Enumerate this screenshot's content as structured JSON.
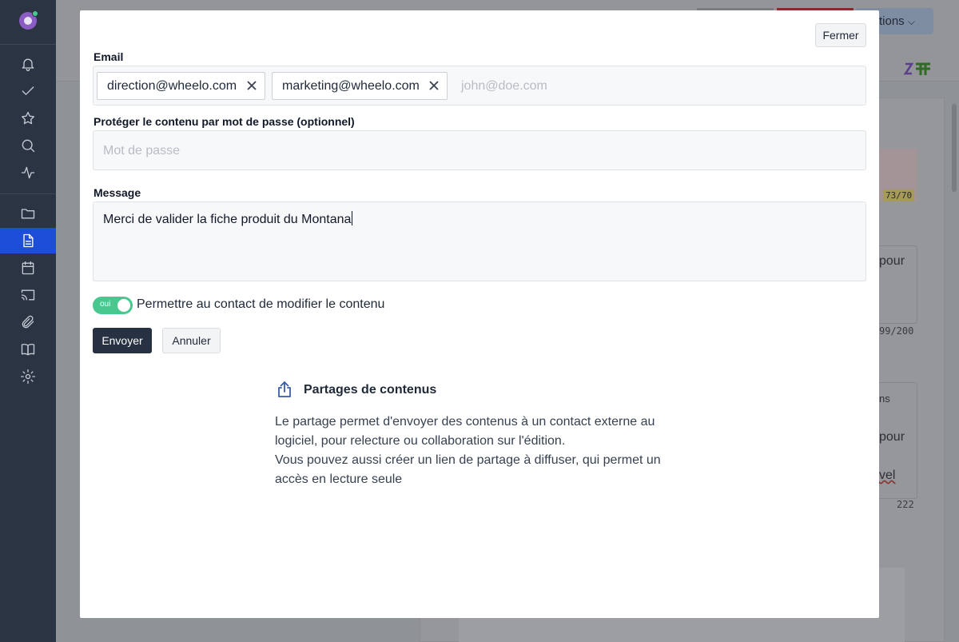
{
  "background": {
    "actions_label": "tions",
    "badge_count": "73/70",
    "snippet_pour_1": "pour",
    "counter_1": "99/200",
    "col_header": "ns",
    "snippet_pour_2": "pour",
    "snippet_vel": "vel",
    "counter_2": "222"
  },
  "modal": {
    "close_label": "Fermer",
    "email": {
      "label": "Email",
      "tags": [
        "direction@wheelo.com",
        "marketing@wheelo.com"
      ],
      "placeholder": "john@doe.com"
    },
    "password": {
      "label": "Protéger le contenu par mot de passe (optionnel)",
      "placeholder": "Mot de passe"
    },
    "message": {
      "label": "Message",
      "value": "Merci de valider la fiche produit du Montana"
    },
    "toggle": {
      "state_label": "oui",
      "label": "Permettre au contact de modifier le contenu",
      "on": true
    },
    "send_label": "Envoyer",
    "cancel_label": "Annuler",
    "info": {
      "title": "Partages de contenus",
      "lines": [
        "Le partage permet d'envoyer des contenus à un contact externe au",
        "logiciel, pour relecture ou collaboration sur l'édition.",
        "Vous pouvez aussi créer un lien de partage à diffuser, qui permet un",
        "accès en lecture seule"
      ]
    }
  },
  "colors": {
    "sidebar_bg": "#2b3442",
    "active_item": "#1d4ed8",
    "toggle_on": "#48c78e",
    "primary_button": "#273142"
  }
}
